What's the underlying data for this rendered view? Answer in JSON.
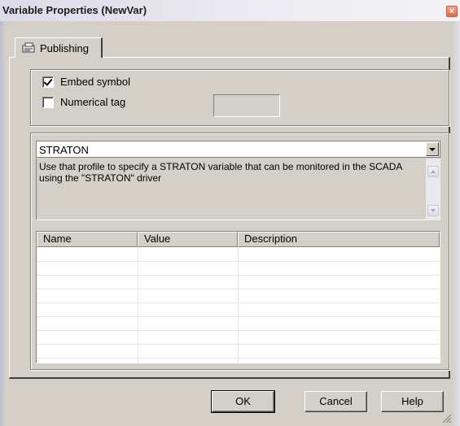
{
  "window": {
    "title": "Variable Properties (NewVar)",
    "close_symbol": "×"
  },
  "tabs": [
    {
      "label": "Publishing",
      "icon": "publishing-icon",
      "selected": true
    }
  ],
  "options": {
    "embed_symbol": {
      "label": "Embed symbol",
      "checked": true
    },
    "numerical_tag": {
      "label": "Numerical tag",
      "checked": false,
      "value": ""
    }
  },
  "profile": {
    "selected": "STRATON",
    "description": "Use that profile to specify a STRATON variable that can be monitored in the SCADA using the \"STRATON\" driver"
  },
  "properties_table": {
    "columns": [
      "Name",
      "Value",
      "Description"
    ],
    "rows": []
  },
  "buttons": {
    "ok": "OK",
    "cancel": "Cancel",
    "help": "Help"
  },
  "colors": {
    "dialog_face": "#d4d0c8",
    "close_button": "#e16a4c"
  }
}
